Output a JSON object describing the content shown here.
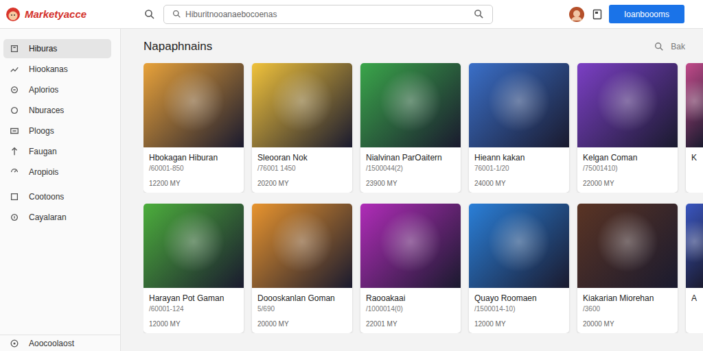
{
  "app": {
    "logo": "Marketyacce"
  },
  "search": {
    "placeholder": "Hiburitnooanaebocoenas"
  },
  "topbar": {
    "button": "Ioanboooms"
  },
  "sidebar": {
    "items": [
      {
        "label": "Hiburas",
        "selected": true
      },
      {
        "label": "Hiookanas",
        "selected": false
      },
      {
        "label": "Aplorios",
        "selected": false
      },
      {
        "label": "Nburaces",
        "selected": false
      },
      {
        "label": "Ploogs",
        "selected": false
      },
      {
        "label": "Faugan",
        "selected": false
      },
      {
        "label": "Aropiois",
        "selected": false
      },
      {
        "label": "Cootoons",
        "selected": false
      },
      {
        "label": "Cayalaran",
        "selected": false
      }
    ],
    "footer": {
      "label": "Aoocoolaost"
    }
  },
  "section": {
    "title": "Napaphnains",
    "action": "Bak"
  },
  "rows": [
    [
      {
        "title": "Hbokagan Hiburan",
        "sub": "/60001-850",
        "price": "12200 MY",
        "color": "#e8a23a",
        "partial": false
      },
      {
        "title": "Sleooran Nok",
        "sub": "/76001 1450",
        "price": "20200 MY",
        "color": "#f0c23b",
        "partial": false
      },
      {
        "title": "Nialvinan ParOaitern",
        "sub": "/1500044(2)",
        "price": "23900 MY",
        "color": "#3aa64a",
        "partial": false
      },
      {
        "title": "Hieann kakan",
        "sub": "76001-1/20",
        "price": "24000 MY",
        "color": "#3a6fc8",
        "partial": false
      },
      {
        "title": "Kelgan Coman",
        "sub": "/75001410)",
        "price": "22000 MY",
        "color": "#7b3fc4",
        "partial": false
      },
      {
        "title": "K",
        "color": "#c24a8a",
        "partial": true
      }
    ],
    [
      {
        "title": "Harayan Pot Gaman",
        "sub": "/60001-124",
        "price": "12000 MY",
        "color": "#4cae3c",
        "partial": false
      },
      {
        "title": "Doooskanlan Goman",
        "sub": "5/690",
        "price": "20000 MY",
        "color": "#e8942e",
        "partial": false
      },
      {
        "title": "Raooakaai",
        "sub": "/1000014(0)",
        "price": "22001 MY",
        "color": "#b02cb8",
        "partial": false
      },
      {
        "title": "Quayo Roomaen",
        "sub": "/1500014-10)",
        "price": "12000 MY",
        "color": "#2a7fd8",
        "partial": false
      },
      {
        "title": "Kiakarian Miorehan",
        "sub": "/3600",
        "price": "20000 MY",
        "color": "#5a3424",
        "partial": false
      },
      {
        "title": "A",
        "color": "#3a56c0",
        "partial": true
      }
    ]
  ]
}
